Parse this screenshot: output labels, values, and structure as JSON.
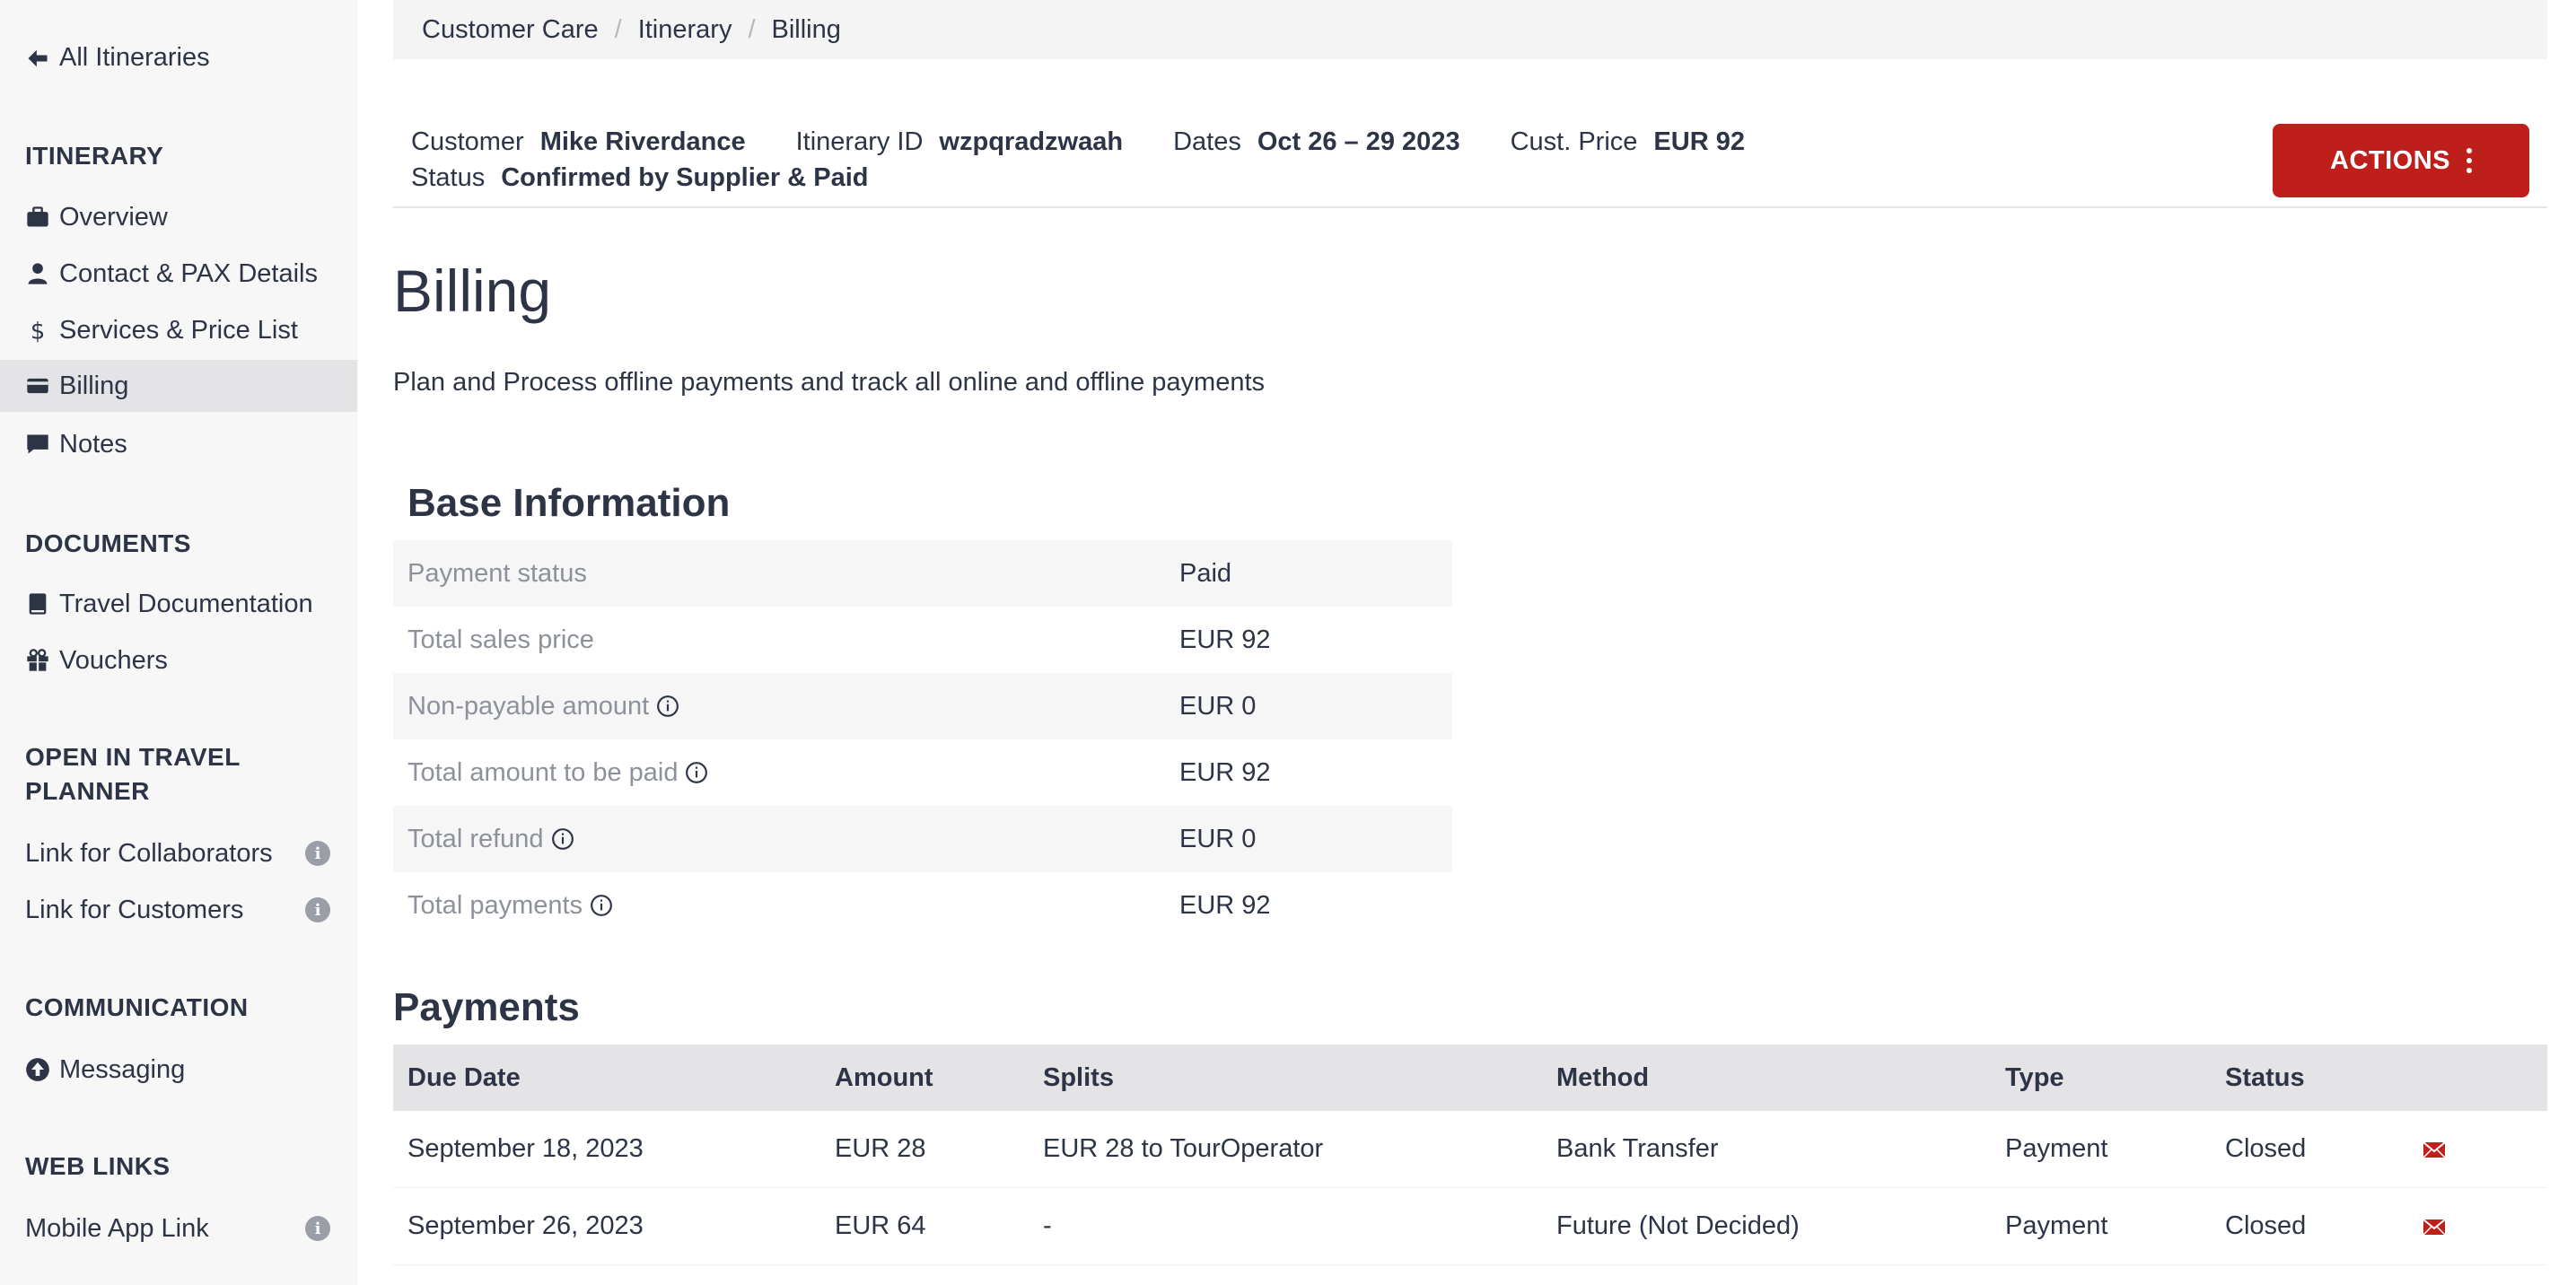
{
  "sidebar": {
    "back_label": "All Itineraries",
    "sections": {
      "itinerary": "ITINERARY",
      "documents": "DOCUMENTS",
      "open_in_travel_planner_l1": "OPEN IN TRAVEL",
      "open_in_travel_planner_l2": "PLANNER",
      "communication": "COMMUNICATION",
      "web_links": "WEB LINKS"
    },
    "items": {
      "overview": "Overview",
      "contact": "Contact & PAX Details",
      "services": "Services & Price List",
      "billing": "Billing",
      "notes": "Notes",
      "travel_docs": "Travel Documentation",
      "vouchers": "Vouchers",
      "collaborators_link": "Link for Collaborators",
      "customers_link": "Link for Customers",
      "messaging": "Messaging",
      "mobile_app_link": "Mobile App Link"
    },
    "active_item": "billing"
  },
  "breadcrumb": {
    "items": [
      "Customer Care",
      "Itinerary",
      "Billing"
    ]
  },
  "header": {
    "customer_label": "Customer",
    "customer_value": "Mike Riverdance",
    "itinerary_id_label": "Itinerary ID",
    "itinerary_id_value": "wzpqradzwaah",
    "dates_label": "Dates",
    "dates_value": "Oct 26 – 29 2023",
    "price_label": "Cust. Price",
    "price_value": "EUR 92",
    "status_label": "Status",
    "status_value": "Confirmed by Supplier & Paid",
    "actions_label": "ACTIONS"
  },
  "page": {
    "title": "Billing",
    "description": "Plan and Process offline payments and track all online and offline payments"
  },
  "base_info": {
    "title": "Base Information",
    "rows": [
      {
        "label": "Payment status",
        "value": "Paid"
      },
      {
        "label": "Total sales price",
        "value": "EUR 92"
      },
      {
        "label": "Non-payable amount",
        "value": "EUR 0"
      },
      {
        "label": "Total amount to be paid",
        "value": "EUR 92"
      },
      {
        "label": "Total refund",
        "value": "EUR 0"
      },
      {
        "label": "Total payments",
        "value": "EUR 92"
      }
    ]
  },
  "payments": {
    "title": "Payments",
    "columns": [
      "Due Date",
      "Amount",
      "Splits",
      "Method",
      "Type",
      "Status"
    ],
    "rows": [
      {
        "due_date": "September 18, 2023",
        "amount": "EUR 28",
        "splits": "EUR 28 to TourOperator",
        "method": "Bank Transfer",
        "type": "Payment",
        "status": "Closed"
      },
      {
        "due_date": "September 26, 2023",
        "amount": "EUR 64",
        "splits": "-",
        "method": "Future (Not Decided)",
        "type": "Payment",
        "status": "Closed"
      }
    ]
  },
  "colors": {
    "accent": "#bf1f1a",
    "text": "#2c3445",
    "muted": "#8c919a",
    "sidebar_bg": "#f7f7f8",
    "active_bg": "#e4e4e6"
  }
}
